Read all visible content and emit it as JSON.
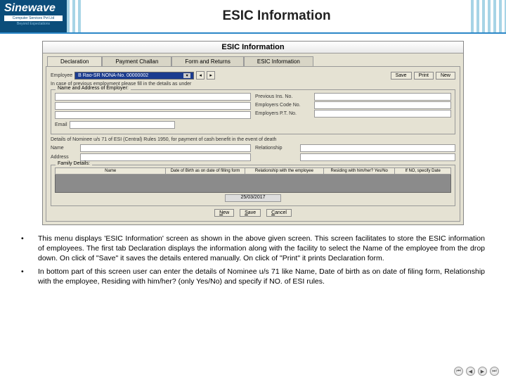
{
  "header": {
    "brand": "Sinewave",
    "brand_sub": "Computer Services Pvt Ltd",
    "brand_tag": "Beyond Expectations",
    "page_title": "ESIC Information"
  },
  "app": {
    "window_title": "ESIC Information",
    "tabs": [
      "Declaration",
      "Payment Challan",
      "Form and Returns",
      "ESIC Information"
    ],
    "employee_label": "Employee",
    "employee_value": "B Rao-SR NONA-No. 00000002",
    "btn_save": "Save",
    "btn_print": "Print",
    "btn_new": "New",
    "prev_emp_note": "In case of previous employment please fill in the details as under",
    "group1_legend": "Name and Address of Employer:",
    "f_prev_ins": "Previous Ins. No.",
    "f_emp_code": "Employers Code No.",
    "f_emp_pt": "Employers P.T. No.",
    "email_label": "Email",
    "nominee_note": "Details of Nominee u/s 71 of ESI (Central) Rules 1950, for payment of cash benefit in the event of death",
    "f_name": "Name",
    "f_relationship": "Relationship",
    "f_address": "Address",
    "family_legend": "Family Details:",
    "family_headers": [
      "Name",
      "Date of Birth as on date of filling form",
      "Relationship with the employee",
      "Residing with him/her? Yes/No",
      "If NO, specify Date"
    ],
    "scroll_mark": "25/03/2017",
    "btn_new2": "New",
    "btn_save2": "Save",
    "btn_cancel": "Cancel"
  },
  "desc": {
    "p1": "This menu displays 'ESIC Information' screen as shown in the above given screen. This screen facilitates to store the ESIC information of employees. The first tab Declaration displays the information along with the facility to select the Name of the employee from the drop down. On click of \"Save\" it saves the details entered manually. On click of \"Print\" it prints Declaration form.",
    "p2": "In bottom part of this screen user can enter the details of Nominee u/s 71 like Name, Date of birth as on date of filing form, Relationship with the employee, Residing with him/her? (only Yes/No) and specify if NO.  of ESI rules."
  },
  "nav": {
    "first": "⏮",
    "prev": "◀",
    "next": "▶",
    "last": "⏭"
  }
}
